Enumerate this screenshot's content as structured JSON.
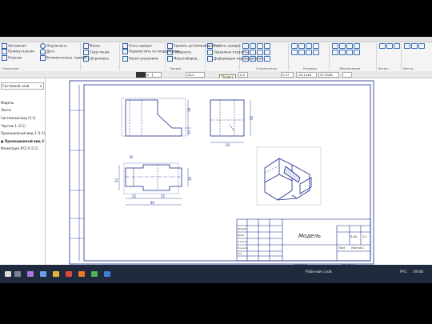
{
  "ribbon": {
    "group1": [
      "Автолиния",
      "Прямоугольник",
      "Окружность",
      "Дуга",
      "Отрезок",
      "Вспомогательн. прямая",
      "Геометрия"
    ],
    "group2": [
      "Фаска",
      "Скругление",
      "Штриховка"
    ],
    "group3": [
      "Усечь кривую",
      "Переместить по координатам",
      "Копия указанием"
    ],
    "group4": [
      "Удалить до ближайшего о...",
      "Повернуть",
      "Масштабиров..."
    ],
    "group5": [
      "Разбить кривую",
      "Зеркально отразить",
      "Деформация перемещением"
    ],
    "label_edit": "Правка",
    "label_constraints": "Ограничения",
    "label_dims": "Размеры",
    "label_marks": "Обозначения",
    "label_inser": "Встав...",
    "label_instr": "Инстр..."
  },
  "propbar": {
    "field1": "Сб.0",
    "field2": "0.57",
    "field3": "-35.1446",
    "field4": "97.9458",
    "field5": "0.0",
    "tooltip": "Правка"
  },
  "leftpanel": {
    "selector": "Составной слой",
    "items": [
      "Модель",
      "Листы",
      "Системный вид (1:1)",
      "Чертеж 1 (1:1)",
      "Проекционный вид 2 (1:1)",
      "Проекционный вид 3",
      "Изометрия XYZ 4 (1:1)"
    ]
  },
  "drawing": {
    "title": "Модель",
    "dims": {
      "top_right_height": "50",
      "top_right_width": "50",
      "front_right": "38",
      "front_left": "10",
      "plan_left": "42",
      "plan_top": "10",
      "plan_bottom_a": "25",
      "plan_bottom_b": "55",
      "plan_bottom_total": "80",
      "plan_right": "16"
    },
    "stamp": {
      "scale": "1:1",
      "mass": "0,64",
      "row_labels": [
        "Разраб.",
        "Пров.",
        "Т.контр.",
        "Н.контр.",
        "Утв."
      ],
      "sheet": "Лист",
      "sheets": "Листов 1",
      "copied": "Копировал",
      "format": "Формат A3"
    }
  },
  "taskbar": {
    "layer": "Рабочий слой",
    "lang": "РУС",
    "time": "19:06"
  },
  "colors": {
    "ribbon_bg": "#f4f4f4",
    "accent": "#2c5fa8",
    "taskbar": "#1f2a3c",
    "drawing_line": "#1a2a8a"
  }
}
